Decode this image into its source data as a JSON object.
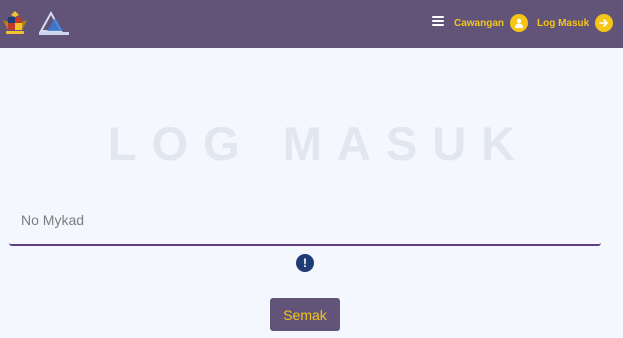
{
  "header": {
    "nav": {
      "branch_label": "Cawangan",
      "login_label": "Log Masuk"
    }
  },
  "main": {
    "heading": "LOG MASUK",
    "mykad_input": {
      "placeholder": "No Mykad",
      "value": ""
    },
    "alert_symbol": "!",
    "check_button_label": "Semak"
  },
  "icons": {
    "crest": "malaysia-coat-of-arms-icon",
    "agency_logo": "agency-logo-icon",
    "menu": "hamburger-menu-icon",
    "branch": "user-icon",
    "login": "arrow-right-icon",
    "alert": "exclamation-circle-icon"
  },
  "colors": {
    "header_bg": "#625478",
    "accent": "#f5c518",
    "page_bg": "#f4f7fd",
    "heading_text": "#e1e6ef",
    "input_underline": "#5e3f86",
    "alert_bg": "#1f3b73"
  }
}
